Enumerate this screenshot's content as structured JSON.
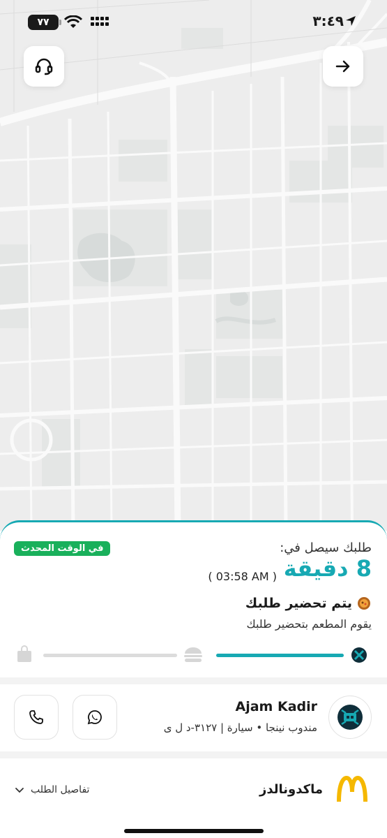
{
  "status_bar": {
    "time": "٣:٤٩",
    "battery": "٧٧"
  },
  "map": {
    "icons": [
      "headset-icon",
      "arrow-right-icon"
    ]
  },
  "order": {
    "arrive_label": "طلبك سيصل في:",
    "eta": "8 دقيقة",
    "eta_time": "( 03:58 AM )",
    "live_badge": "في الوقت المحدث",
    "status_title": "يتم تحضير طلبك",
    "status_subtitle": "يقوم المطعم بتحضير طلبك",
    "progress_steps": [
      "restaurant-icon",
      "burger-icon",
      "bag-icon"
    ],
    "progress_first_segment": 1.0,
    "progress_second_segment": 0.0
  },
  "driver": {
    "name": "Ajam Kadir",
    "info": "مندوب نينجا • سيارة | ٣١٢٧-د ل ى"
  },
  "restaurant": {
    "name": "ماكدونالدز",
    "details_label": "تفاصيل الطلب"
  },
  "colors": {
    "accent": "#17a9b3",
    "badge": "#19b05b"
  }
}
